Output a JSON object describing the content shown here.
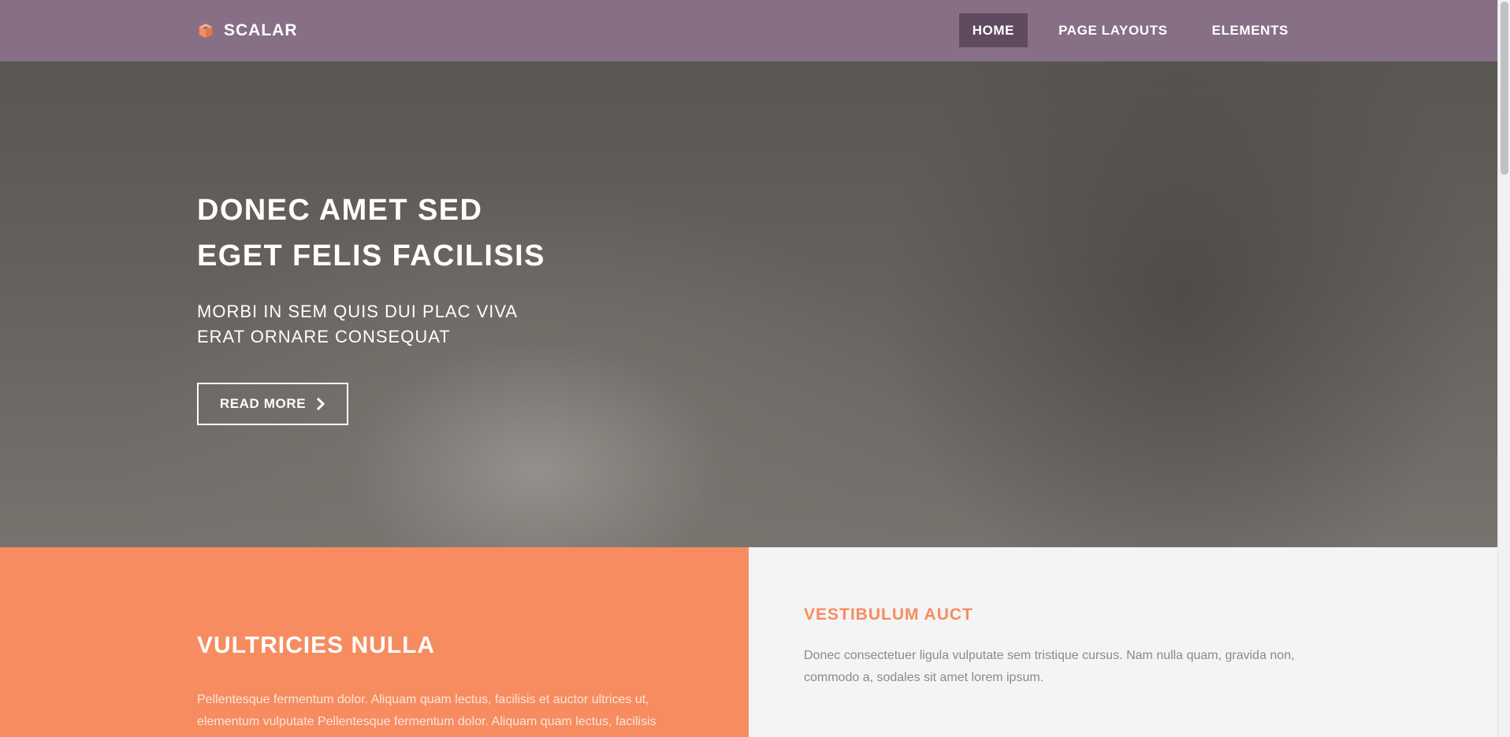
{
  "brand": {
    "name": "SCALAR",
    "icon": "cube-icon",
    "icon_color": "#f68c60"
  },
  "nav": {
    "items": [
      {
        "label": "HOME",
        "active": true
      },
      {
        "label": "PAGE LAYOUTS",
        "active": false
      },
      {
        "label": "ELEMENTS",
        "active": false
      }
    ]
  },
  "hero": {
    "title_line1": "DONEC AMET SED",
    "title_line2": "EGET FELIS FACILISIS",
    "subtitle_line1": "MORBI IN SEM QUIS DUI PLAC VIVA",
    "subtitle_line2": "ERAT ORNARE CONSEQUAT",
    "button_label": "READ MORE",
    "button_icon": "chevron-right-icon"
  },
  "left_section": {
    "title": "VULTRICIES NULLA",
    "text": "Pellentesque fermentum dolor. Aliquam quam lectus, facilisis et auctor ultrices ut, elementum vulputate Pellentesque fermentum dolor. Aliquam quam lectus, facilisis"
  },
  "right_section": {
    "title": "VESTIBULUM AUCT",
    "text": "Donec consectetuer ligula vulputate sem tristique cursus. Nam nulla quam, gravida non, commodo a, sodales sit amet lorem ipsum."
  },
  "colors": {
    "header": "#876f86",
    "nav_active": "#5f4a60",
    "accent": "#f68c60",
    "light_panel": "#f4f4f4"
  }
}
